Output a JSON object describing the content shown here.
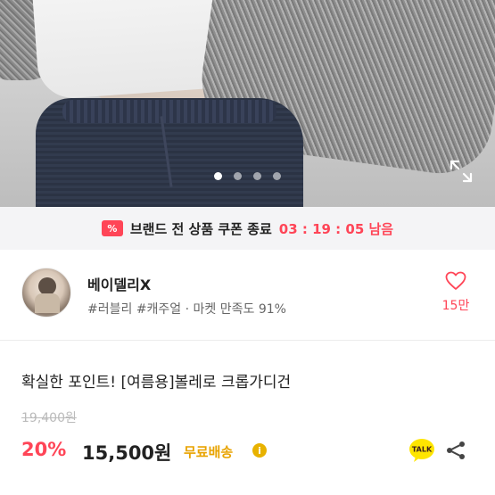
{
  "gallery": {
    "dots": [
      true,
      false,
      false,
      false
    ],
    "expand_icon": "expand-icon"
  },
  "coupon": {
    "icon_text": "%",
    "text": "브랜드 전 상품 쿠폰 종료",
    "timer": "03 : 19 : 05 남음",
    "color": "#ff4557"
  },
  "seller": {
    "name": "베이델리X",
    "meta": "#러블리 #캐주얼 · 마켓 만족도 91%",
    "likes": "15만"
  },
  "product": {
    "title": "확실한 포인트! [여름용]볼레로 크롭가디건",
    "original_price": "19,400원",
    "discount": "20%",
    "price": "15,500원",
    "shipping": "무료배송",
    "info_icon": "i",
    "talk_label": "TALK"
  },
  "colors": {
    "accent": "#ff4557",
    "shipping": "#e8a300",
    "talk": "#fee500"
  }
}
